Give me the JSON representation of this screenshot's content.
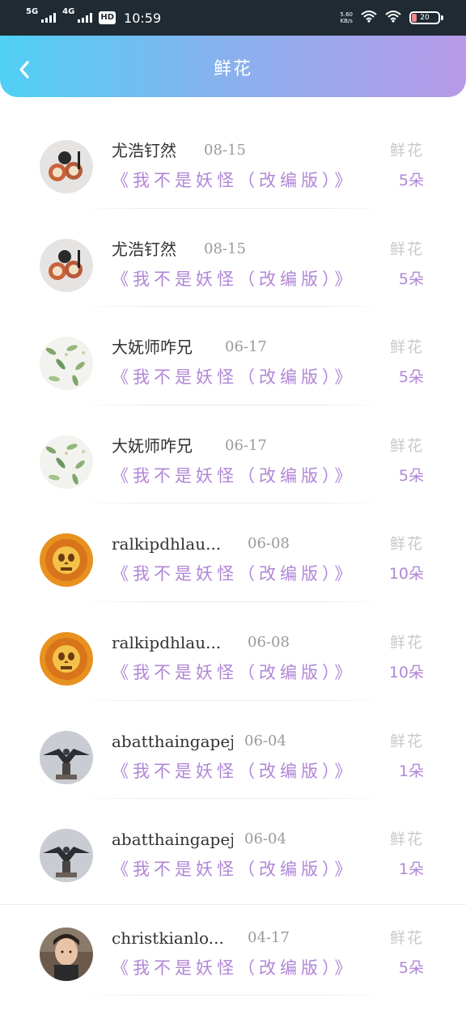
{
  "status_bar": {
    "signal1": "5G",
    "signal2": "4G",
    "hd": "HD",
    "time": "10:59",
    "net_speed": "5.60",
    "net_unit": "KB/s",
    "battery": "20",
    "battery_level": 0.2
  },
  "header": {
    "title": "鲜花",
    "back_icon": "chevron-left-icon",
    "gradient": [
      "#4fd0f5",
      "#b79ae8"
    ]
  },
  "colors": {
    "accent": "#b086d6",
    "muted": "#c9c9c9"
  },
  "records": [
    {
      "user": "尤浩钉然",
      "date": "08-15",
      "work": "《我不是妖怪（改编版）》",
      "gift": "鲜花",
      "count": "5朵",
      "avatar": "avatar-food"
    },
    {
      "user": "尤浩钉然",
      "date": "08-15",
      "work": "《我不是妖怪（改编版）》",
      "gift": "鲜花",
      "count": "5朵",
      "avatar": "avatar-food"
    },
    {
      "user": "大妩师咋兄",
      "date": "06-17",
      "work": "《我不是妖怪（改编版）》",
      "gift": "鲜花",
      "count": "5朵",
      "avatar": "avatar-leaves"
    },
    {
      "user": "大妩师咋兄",
      "date": "06-17",
      "work": "《我不是妖怪（改编版）》",
      "gift": "鲜花",
      "count": "5朵",
      "avatar": "avatar-leaves"
    },
    {
      "user": "ralkipdhlau...",
      "date": "06-08",
      "work": "《我不是妖怪（改编版）》",
      "gift": "鲜花",
      "count": "10朵",
      "avatar": "avatar-skull"
    },
    {
      "user": "ralkipdhlau...",
      "date": "06-08",
      "work": "《我不是妖怪（改编版）》",
      "gift": "鲜花",
      "count": "10朵",
      "avatar": "avatar-skull"
    },
    {
      "user": "abatthaingapej",
      "date": "06-04",
      "work": "《我不是妖怪（改编版）》",
      "gift": "鲜花",
      "count": "1朵",
      "avatar": "avatar-eagle"
    },
    {
      "user": "abatthaingapej",
      "date": "06-04",
      "work": "《我不是妖怪（改编版）》",
      "gift": "鲜花",
      "count": "1朵",
      "avatar": "avatar-eagle"
    },
    {
      "user": "christkianlo...",
      "date": "04-17",
      "work": "《我不是妖怪（改编版）》",
      "gift": "鲜花",
      "count": "5朵",
      "avatar": "avatar-person"
    }
  ]
}
